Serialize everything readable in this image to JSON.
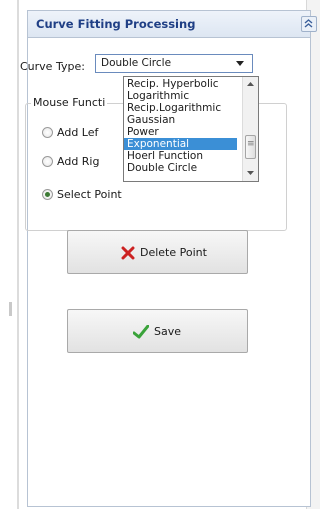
{
  "panel": {
    "title": "Curve Fitting Processing"
  },
  "curve_type": {
    "label": "Curve Type:",
    "selected": "Double Circle",
    "options": [
      "Recip. Hyperbolic",
      "Logarithmic",
      "Recip.Logarithmic",
      "Gaussian",
      "Power",
      "Exponential",
      "Hoerl Function",
      "Double Circle"
    ],
    "highlighted": "Exponential"
  },
  "mouse_function": {
    "legend": "Mouse Functi",
    "add_left": "Add Lef",
    "add_right": "Add Rig",
    "select_point": "Select Point",
    "checked": "select_point"
  },
  "buttons": {
    "delete": "Delete Point",
    "save": "Save"
  },
  "colors": {
    "header_text": "#1f3f85",
    "highlight": "#3b8fd6",
    "delete_icon": "#cc2222",
    "save_icon": "#3aa33a"
  },
  "icons": {
    "collapse": "double-chevron-up-icon",
    "delete": "red-x-icon",
    "save": "green-check-icon"
  }
}
